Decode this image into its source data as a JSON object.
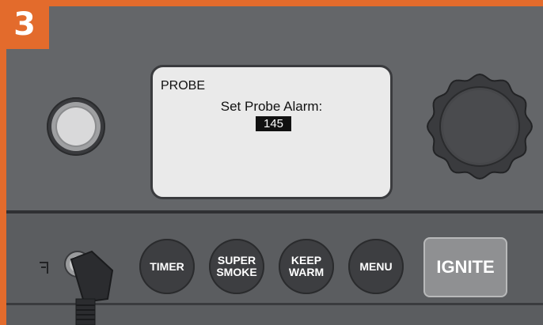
{
  "step_badge": "3",
  "display": {
    "mode_title": "PROBE",
    "prompt": "Set Probe Alarm:",
    "value": "145"
  },
  "buttons": {
    "timer": "TIMER",
    "super_smoke": "SUPER\nSMOKE",
    "keep_warm": "KEEP\nWARM",
    "menu": "MENU",
    "ignite": "IGNITE"
  },
  "icons": {
    "power": "power-button-icon",
    "dial": "selection-dial-icon",
    "probe_port": "probe-port-icon",
    "probe_plug": "probe-plug-icon"
  },
  "colors": {
    "accent": "#e36b2c",
    "panel": "#646669",
    "lcd_background": "#eaeaea",
    "button": "#3d3e41",
    "ignite_button": "#8f9092"
  }
}
